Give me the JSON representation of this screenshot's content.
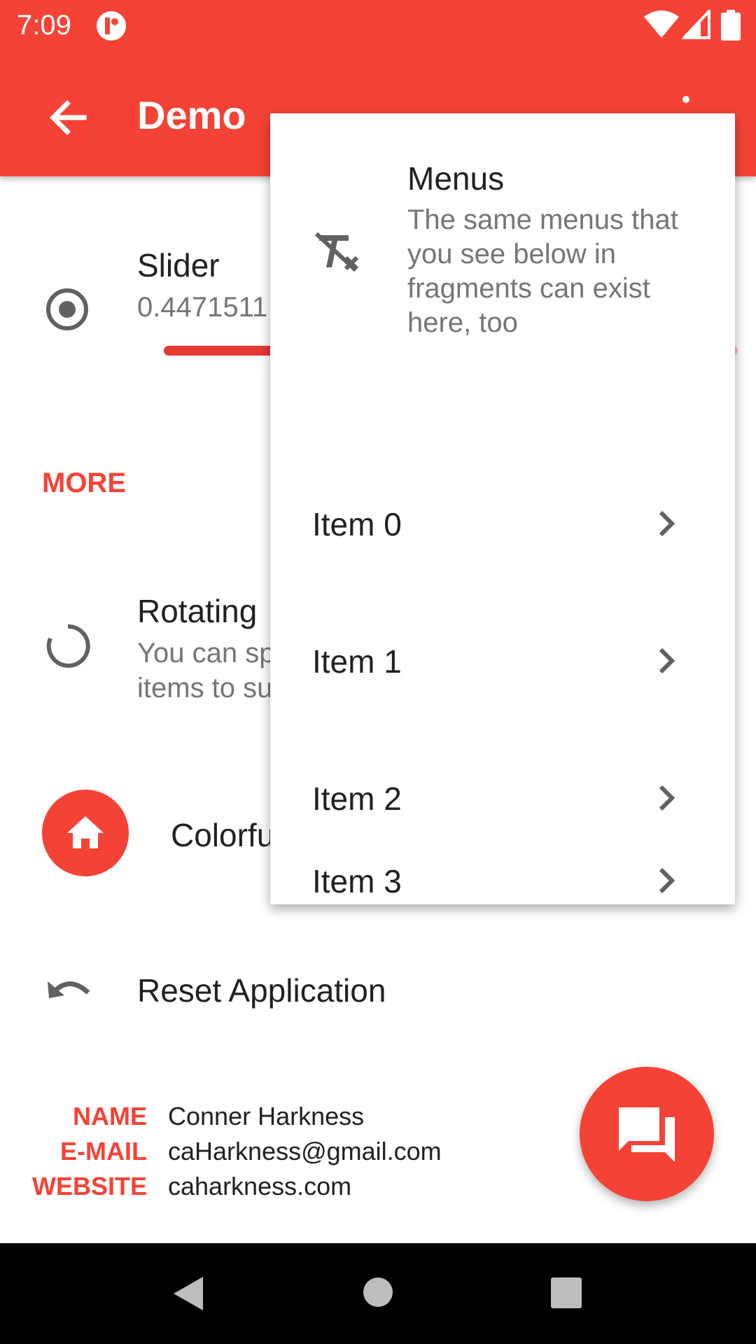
{
  "status_bar": {
    "time": "7:09"
  },
  "app_bar": {
    "title": "Demo"
  },
  "slider": {
    "title": "Slider",
    "value_text": "0.4471511",
    "fraction": 0.4471511
  },
  "more_label": "MORE",
  "rotating": {
    "title": "Rotating",
    "subtitle_line1": "You can sp",
    "subtitle_line2": "items to su"
  },
  "colorful": {
    "label": "Colorfu"
  },
  "reset": {
    "label": "Reset Application"
  },
  "info": {
    "name_label": "NAME",
    "name_value": "Conner Harkness",
    "email_label": "E-MAIL",
    "email_value": "caHarkness@gmail.com",
    "website_label": "WEBSITE",
    "website_value": "caharkness.com"
  },
  "popup_menu": {
    "title": "Menus",
    "subtitle": "The same menus that you see below in fragments can exist here, too",
    "items": [
      {
        "label": "Item 0"
      },
      {
        "label": "Item 1"
      },
      {
        "label": "Item 2"
      },
      {
        "label": "Item 3"
      }
    ]
  },
  "colors": {
    "accent": "#f44336",
    "text_primary": "#212121",
    "text_secondary": "#757575"
  },
  "icons": {
    "back": "arrow-left-icon",
    "overflow": "more-vert-icon",
    "slider": "radio-button-icon",
    "rotating": "progress-ring-icon",
    "colorful": "home-icon",
    "reset": "undo-icon",
    "chat": "forum-icon",
    "menu_header": "format-clear-icon",
    "menu_item": "chevron-right-icon"
  }
}
